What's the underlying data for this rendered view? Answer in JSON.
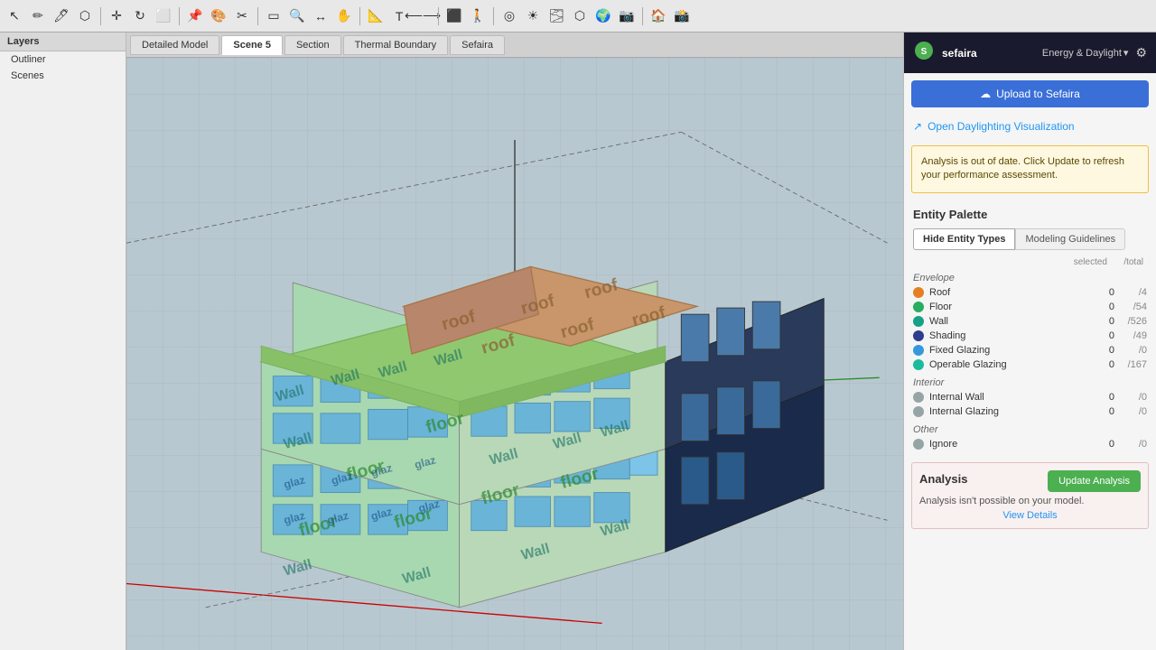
{
  "toolbar": {
    "tools": [
      "↖",
      "✏️",
      "🖊",
      "⬡",
      "✚",
      "↻",
      "⬜",
      "📍",
      "🌿",
      "✂",
      "🔲",
      "🔍",
      "✕",
      "📦",
      "➕",
      "🔍",
      "⊕",
      "📐",
      "🔲",
      "⬜",
      "◉",
      "🔷",
      "🔶",
      "🔸",
      "⬡",
      "🏠",
      "📷",
      "📽",
      "⬜",
      "⬜"
    ]
  },
  "layers_panel": {
    "title": "Layers",
    "items": [
      "Outliner",
      "Scenes"
    ]
  },
  "scene_tabs": {
    "tabs": [
      "Detailed Model",
      "Scene 5",
      "Section",
      "Thermal Boundary",
      "Sefaira"
    ],
    "active": "Scene 5"
  },
  "sefaira": {
    "logo": "⬡",
    "app_name": "sefaira",
    "energy_daylight_label": "Energy & Daylight",
    "gear_icon": "⚙",
    "upload_btn_label": "Upload to Sefaira",
    "upload_icon": "☁",
    "open_daylight_label": "Open Daylighting Visualization",
    "open_daylight_icon": "↗",
    "warning_text": "Analysis is out of date. Click Update to refresh your performance assessment.",
    "entity_palette_title": "Entity Palette",
    "tab_hide": "Hide Entity Types",
    "tab_modeling": "Modeling Guidelines",
    "col_selected": "selected",
    "col_total": "/total",
    "sections": {
      "envelope": {
        "label": "Envelope",
        "items": [
          {
            "name": "Roof",
            "color": "orange",
            "selected": "0",
            "total": "/4"
          },
          {
            "name": "Floor",
            "color": "green",
            "selected": "0",
            "total": "/54"
          },
          {
            "name": "Wall",
            "color": "teal",
            "selected": "0",
            "total": "/526"
          },
          {
            "name": "Shading",
            "color": "blue-dark",
            "selected": "0",
            "total": "/49"
          },
          {
            "name": "Fixed Glazing",
            "color": "blue",
            "selected": "0",
            "total": "/0"
          },
          {
            "name": "Operable Glazing",
            "color": "teal2",
            "selected": "0",
            "total": "/167"
          }
        ]
      },
      "interior": {
        "label": "Interior",
        "items": [
          {
            "name": "Internal Wall",
            "color": "gray",
            "selected": "0",
            "total": "/0"
          },
          {
            "name": "Internal Glazing",
            "color": "gray",
            "selected": "0",
            "total": "/0"
          }
        ]
      },
      "other": {
        "label": "Other",
        "items": [
          {
            "name": "Ignore",
            "color": "gray",
            "selected": "0",
            "total": "/0"
          }
        ]
      }
    },
    "analysis": {
      "title": "Analysis",
      "update_btn": "Update Analysis",
      "error_text": "Analysis isn't possible on your model.",
      "view_details": "View Details"
    }
  }
}
